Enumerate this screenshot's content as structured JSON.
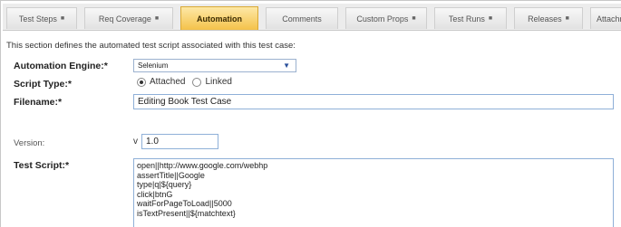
{
  "tabs": [
    {
      "label": "Test Steps",
      "dot": "■",
      "active": false
    },
    {
      "label": "Req Coverage",
      "dot": "■",
      "active": false
    },
    {
      "label": "Automation",
      "dot": "",
      "active": true
    },
    {
      "label": "Comments",
      "dot": "",
      "active": false
    },
    {
      "label": "Custom Props",
      "dot": "■",
      "active": false
    },
    {
      "label": "Test Runs",
      "dot": "■",
      "active": false
    },
    {
      "label": "Releases",
      "dot": "■",
      "active": false
    },
    {
      "label": "Attachm",
      "dot": "",
      "active": false
    }
  ],
  "intro": "This section defines the automated test script associated with this test case:",
  "form": {
    "engine_label": "Automation Engine:*",
    "engine_value": "Selenium",
    "script_type_label": "Script Type:*",
    "script_type_options": [
      "Attached",
      "Linked"
    ],
    "script_type_selected": "Attached",
    "filename_label": "Filename:*",
    "filename_value": "Editing Book Test Case",
    "version_label": "Version:",
    "version_prefix": "v",
    "version_value": "1.0",
    "test_script_label": "Test Script:*",
    "test_script_lines": [
      "open||http://www.google.com/webhp",
      "assertTitle||Google",
      "type|q|${query}",
      "click|btnG",
      "waitForPageToLoad||5000",
      "isTextPresent||${matchtext}"
    ]
  },
  "colors": {
    "active_tab": "#f4c24a",
    "input_border": "#8fb0d8",
    "select_arrow": "#2a4f9b"
  }
}
